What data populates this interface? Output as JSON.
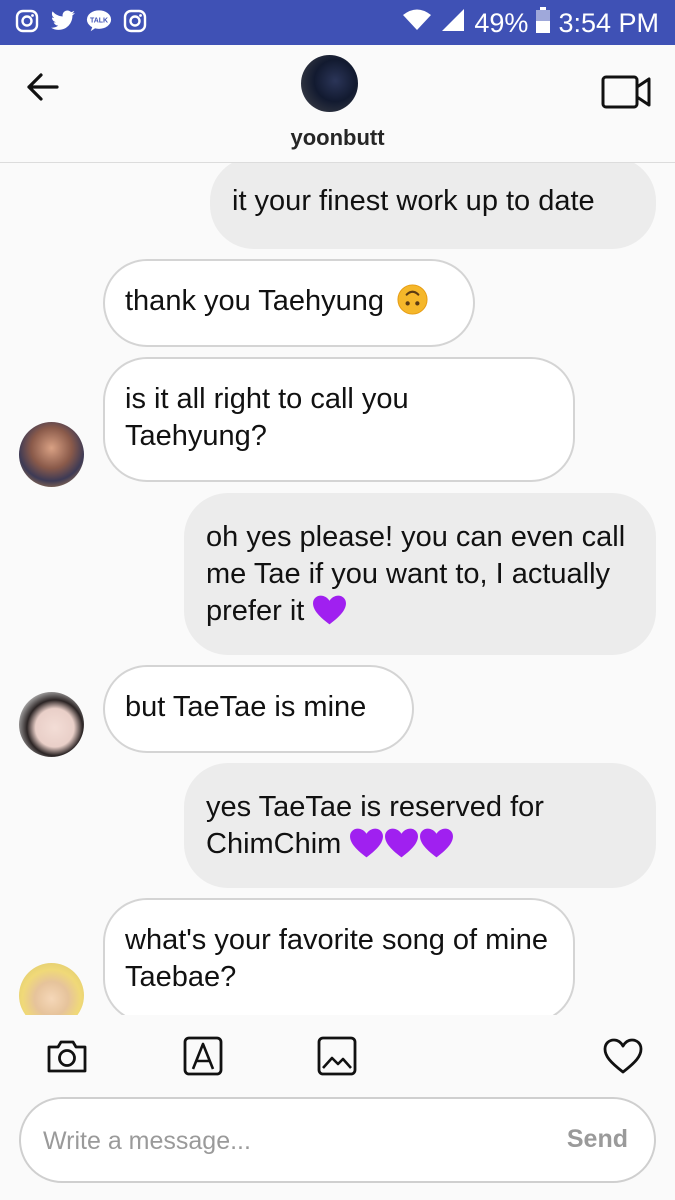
{
  "status_bar": {
    "battery": "49%",
    "time": "3:54 PM",
    "left_icons": [
      "instagram-icon",
      "twitter-icon",
      "kakaotalk-icon",
      "instagram-icon"
    ],
    "kakao_label": "TALK"
  },
  "header": {
    "username": "yoonbutt"
  },
  "messages": [
    {
      "side": "sent",
      "text": "it your finest work up to date"
    },
    {
      "side": "received",
      "text": "thank you Taehyung",
      "emoji": "upside-down-face"
    },
    {
      "side": "received",
      "text": "is it all right to call you Taehyung?"
    },
    {
      "side": "sent",
      "text": "oh yes please! you can even call me Tae if you want to, I actually prefer it",
      "hearts": 1
    },
    {
      "side": "received",
      "text": "but TaeTae is mine"
    },
    {
      "side": "sent",
      "text": "yes TaeTae is reserved for ChimChim",
      "hearts": 3
    },
    {
      "side": "received",
      "text": "what's your favorite song of mine Taebae?"
    }
  ],
  "composer": {
    "placeholder": "Write a message...",
    "send_label": "Send"
  },
  "colors": {
    "status_bar": "#3f51b5",
    "sent_bubble": "#ececec",
    "received_bubble": "#ffffff",
    "heart": "#a020f0"
  }
}
